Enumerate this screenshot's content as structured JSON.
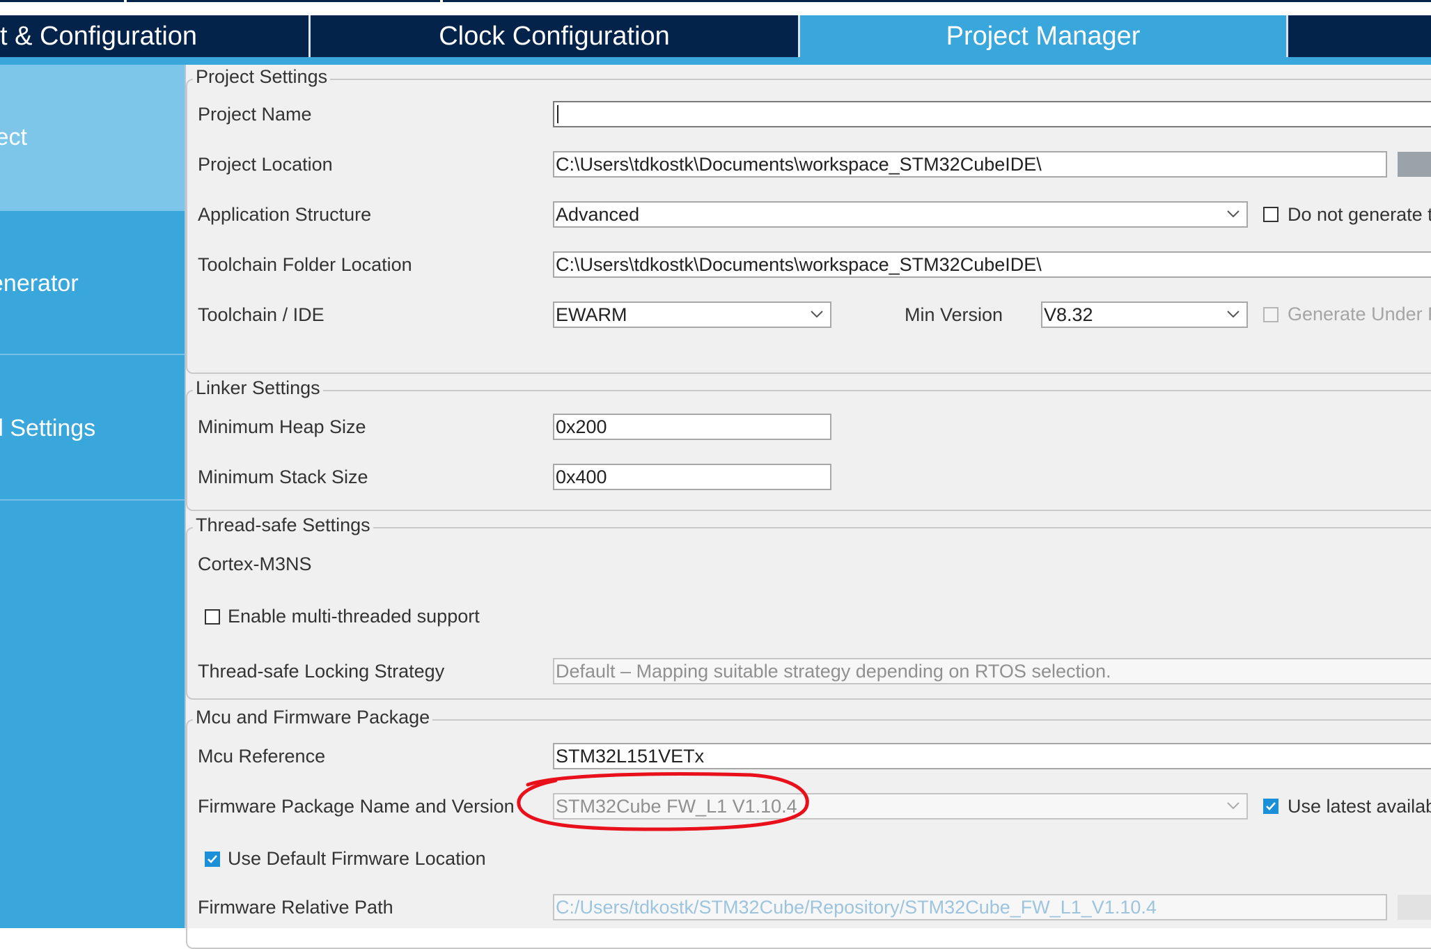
{
  "tabs": [
    {
      "label": "t & Configuration",
      "active": false
    },
    {
      "label": "Clock Configuration",
      "active": false
    },
    {
      "label": "Project Manager",
      "active": true
    },
    {
      "label": "",
      "active": false
    }
  ],
  "sidebar": {
    "items": [
      {
        "label": "ject",
        "selected": true
      },
      {
        "label": "enerator",
        "selected": false
      },
      {
        "label": "d Settings",
        "selected": false
      }
    ]
  },
  "project_settings": {
    "legend": "Project Settings",
    "project_name_label": "Project Name",
    "project_name_value": "",
    "project_location_label": "Project Location",
    "project_location_value": "C:\\Users\\tdkostk\\Documents\\workspace_STM32CubeIDE\\",
    "app_structure_label": "Application Structure",
    "app_structure_value": "Advanced",
    "do_not_generate_label": "Do not generate th",
    "toolchain_folder_label": "Toolchain Folder Location",
    "toolchain_folder_value": "C:\\Users\\tdkostk\\Documents\\workspace_STM32CubeIDE\\",
    "toolchain_ide_label": "Toolchain / IDE",
    "toolchain_ide_value": "EWARM",
    "min_version_label": "Min Version",
    "min_version_value": "V8.32",
    "generate_under_root_label": "Generate Under R"
  },
  "linker_settings": {
    "legend": "Linker Settings",
    "heap_label": "Minimum Heap Size",
    "heap_value": "0x200",
    "stack_label": "Minimum Stack Size",
    "stack_value": "0x400"
  },
  "thread_safe_settings": {
    "legend": "Thread-safe Settings",
    "core_label": "Cortex-M3NS",
    "enable_multithread_label": "Enable multi-threaded support",
    "locking_strategy_label": "Thread-safe Locking Strategy",
    "locking_strategy_value": "Default – Mapping suitable strategy depending on RTOS selection."
  },
  "mcu_firmware": {
    "legend": "Mcu and Firmware Package",
    "mcu_ref_label": "Mcu Reference",
    "mcu_ref_value": "STM32L151VETx",
    "fw_package_label": "Firmware Package Name and Version",
    "fw_package_value": "STM32Cube FW_L1 V1.10.4",
    "use_latest_label": "Use latest availabl",
    "use_default_fw_label": "Use Default Firmware Location",
    "fw_path_label": "Firmware Relative Path",
    "fw_path_value": "C:/Users/tdkostk/STM32Cube/Repository/STM32Cube_FW_L1_V1.10.4"
  },
  "colors": {
    "tab_dark": "#03234b",
    "accent_blue": "#3aa7dc",
    "sidebar_selected": "#7dc6ea",
    "annotation_red": "#e8101b"
  },
  "icons": [
    "chevron-down-icon",
    "checkmark-icon",
    "red-circle-annotation"
  ]
}
